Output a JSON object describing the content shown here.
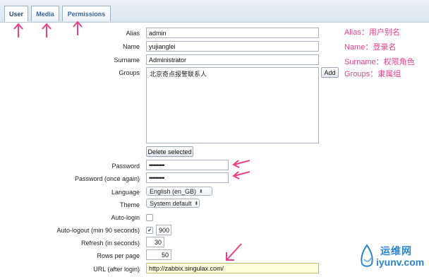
{
  "tabs": [
    {
      "label": "User",
      "active": true
    },
    {
      "label": "Media",
      "active": false
    },
    {
      "label": "Permissions",
      "active": false
    }
  ],
  "form": {
    "alias_label": "Alias",
    "alias_value": "admin",
    "name_label": "Name",
    "name_value": "yujianglei",
    "surname_label": "Surname",
    "surname_value": "Administrator",
    "groups_label": "Groups",
    "groups_items": [
      "北京奇点报警联系人"
    ],
    "add_label": "Add",
    "delete_selected_label": "Delete selected",
    "password_label": "Password",
    "password_value": "••••••••••",
    "password_again_label": "Password (once again)",
    "password_again_value": "••••••••••",
    "language_label": "Language",
    "language_value": "English (en_GB)",
    "theme_label": "Theme",
    "theme_value": "System default",
    "autologin_label": "Auto-login",
    "autologin_checked": false,
    "autologout_label": "Auto-logout (min 90 seconds)",
    "autologout_checked": true,
    "autologout_value": "900",
    "refresh_label": "Refresh (in seconds)",
    "refresh_value": "30",
    "rows_label": "Rows per page",
    "rows_value": "50",
    "url_label": "URL (after login)",
    "url_value": "http://zabbix.singulax.com/"
  },
  "annotations": {
    "alias": "Alias：用户别名",
    "name": "Name：登录名",
    "surname": "Surname：权限角色",
    "groups": "Groups：隶属组"
  },
  "watermark": {
    "cn": "运维网",
    "en": "iyunv.com"
  },
  "colors": {
    "annotation": "#e8418a",
    "tab_text": "#3a66a0",
    "watermark": "#2d84c8"
  }
}
